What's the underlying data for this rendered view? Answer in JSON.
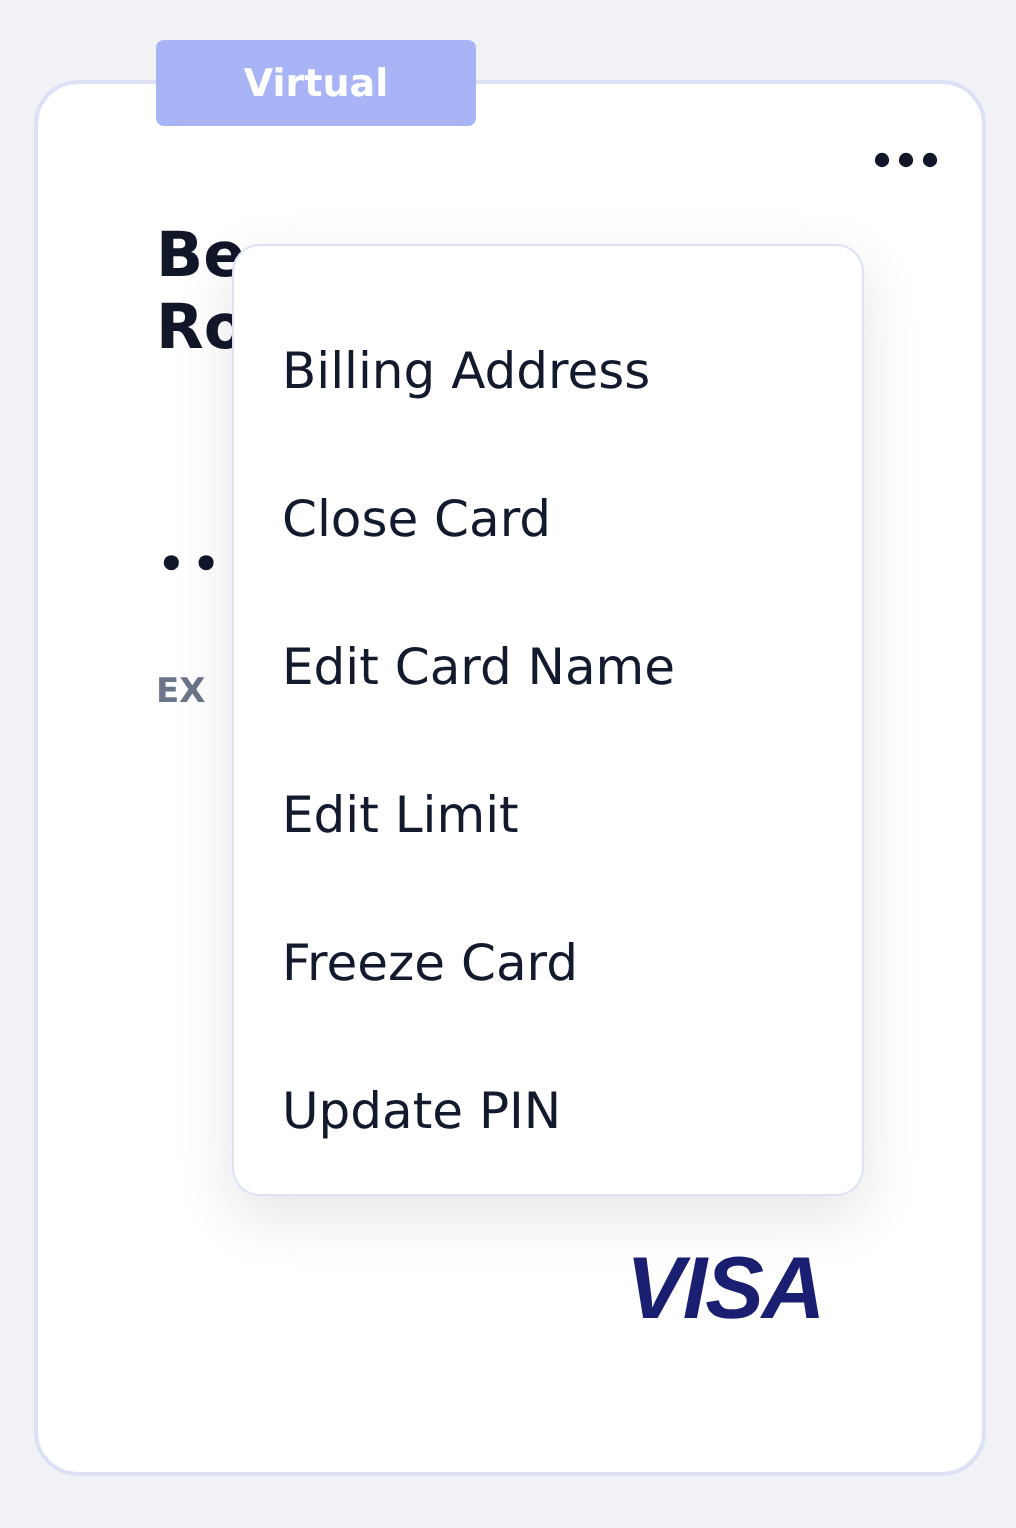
{
  "card": {
    "badge": "Virtual",
    "title_lines": [
      "Be",
      "Ro"
    ],
    "card_number": "••",
    "expiry_label": "EX",
    "brand": "VISA"
  },
  "menu": {
    "items": [
      {
        "label": "Billing Address"
      },
      {
        "label": "Close Card"
      },
      {
        "label": "Edit Card Name"
      },
      {
        "label": "Edit Limit"
      },
      {
        "label": "Freeze Card"
      },
      {
        "label": "Update PIN"
      }
    ]
  }
}
